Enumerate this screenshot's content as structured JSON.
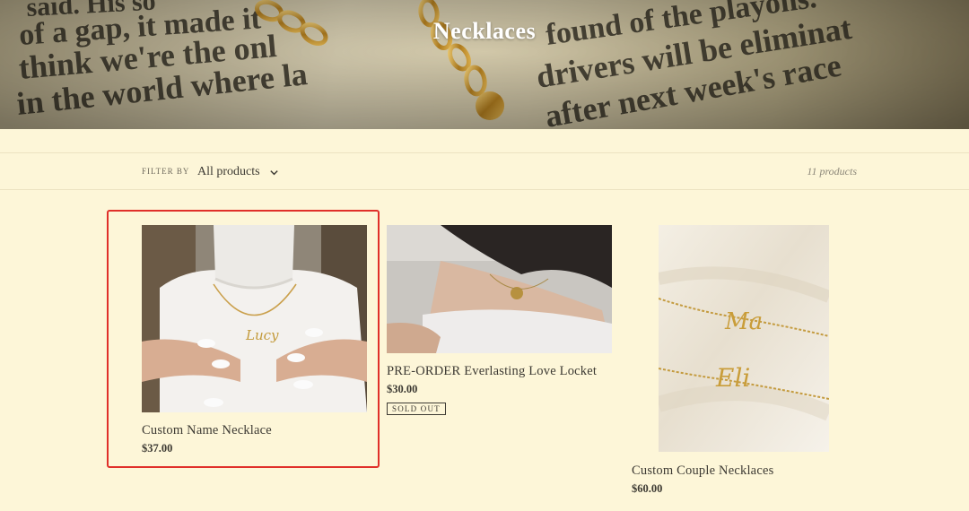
{
  "collection": {
    "title": "Necklaces"
  },
  "filter": {
    "label": "FILTER BY",
    "selected": "All products",
    "count_text": "11 products"
  },
  "products": [
    {
      "title": "Custom Name Necklace",
      "price": "$37.00"
    },
    {
      "title": "PRE-ORDER Everlasting Love Locket",
      "price": "$30.00",
      "badge": "SOLD OUT"
    },
    {
      "title": "Custom Couple Necklaces",
      "price": "$60.00"
    }
  ],
  "colors": {
    "page_background": "#fdf6d8",
    "text": "#3d3a33",
    "highlight_border": "#e0302a"
  },
  "icons": {
    "filter_dropdown": "chevron-down-icon"
  }
}
